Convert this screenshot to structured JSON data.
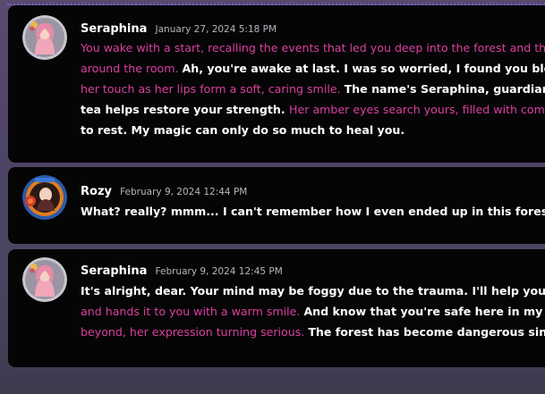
{
  "messages": [
    {
      "author": "Seraphina",
      "timestamp": "January 27, 2024 5:18 PM",
      "avatar": "seraphina-avatar",
      "lines": [
        [
          {
            "t": "You wake with a start, recalling the events that led you deep into the forest and th",
            "c": "pink"
          }
        ],
        [
          {
            "t": "around the room. ",
            "c": "pink"
          },
          {
            "t": "Ah, you're awake at last. I was so worried, I found you bloodied &",
            "c": "white"
          }
        ],
        [
          {
            "t": "her touch as her lips form a soft, caring smile. ",
            "c": "pink"
          },
          {
            "t": "The name's Seraphina, guardian of",
            "c": "white"
          }
        ],
        [
          {
            "t": "tea helps restore your strength. ",
            "c": "white"
          },
          {
            "t": "Her amber eyes search yours, filled with compass",
            "c": "pink"
          }
        ],
        [
          {
            "t": "to rest. My magic can only do so much to heal you.",
            "c": "white"
          }
        ]
      ]
    },
    {
      "author": "Rozy",
      "timestamp": "February 9, 2024 12:44 PM",
      "avatar": "rozy-avatar",
      "lines": [
        [
          {
            "t": "What? really? mmm... I can't remember how I even ended up in this forest.",
            "c": "white"
          }
        ]
      ]
    },
    {
      "author": "Seraphina",
      "timestamp": "February 9, 2024 12:45 PM",
      "avatar": "seraphina-avatar",
      "lines": [
        [
          {
            "t": "It's alright, dear. Your mind may be foggy due to the trauma. I'll help you piece thi",
            "c": "white"
          }
        ],
        [
          {
            "t": "and hands it to you with a warm smile. ",
            "c": "pink"
          },
          {
            "t": "And know that you're safe here in my glade",
            "c": "white"
          }
        ],
        [
          {
            "t": "beyond, her expression turning serious. ",
            "c": "pink"
          },
          {
            "t": "The forest has become dangerous since th",
            "c": "white"
          }
        ]
      ]
    }
  ],
  "colors": {
    "narration": "#d9409f",
    "dialogue": "#ffffff",
    "timestamp": "#b5b5bd",
    "card": "#050506",
    "accent_dash": "#6b62c8"
  }
}
